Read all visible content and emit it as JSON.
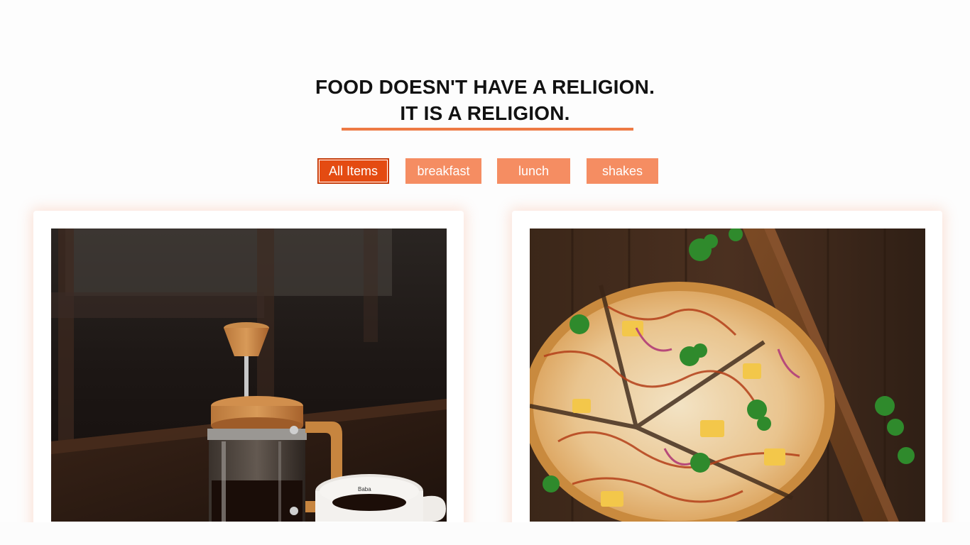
{
  "heading": {
    "line1": "FOOD DOESN'T HAVE A RELIGION.",
    "line2": "IT IS A RELIGION."
  },
  "filters": [
    {
      "label": "All Items",
      "active": true
    },
    {
      "label": "breakfast",
      "active": false
    },
    {
      "label": "lunch",
      "active": false
    },
    {
      "label": "shakes",
      "active": false
    }
  ],
  "colors": {
    "accent": "#ee7a45",
    "button": "#f58d62",
    "button_active": "#e44b12",
    "text": "#121212"
  },
  "cards": [
    {
      "image": "french-press-coffee-photo"
    },
    {
      "image": "pizza-on-wooden-board-photo"
    }
  ]
}
